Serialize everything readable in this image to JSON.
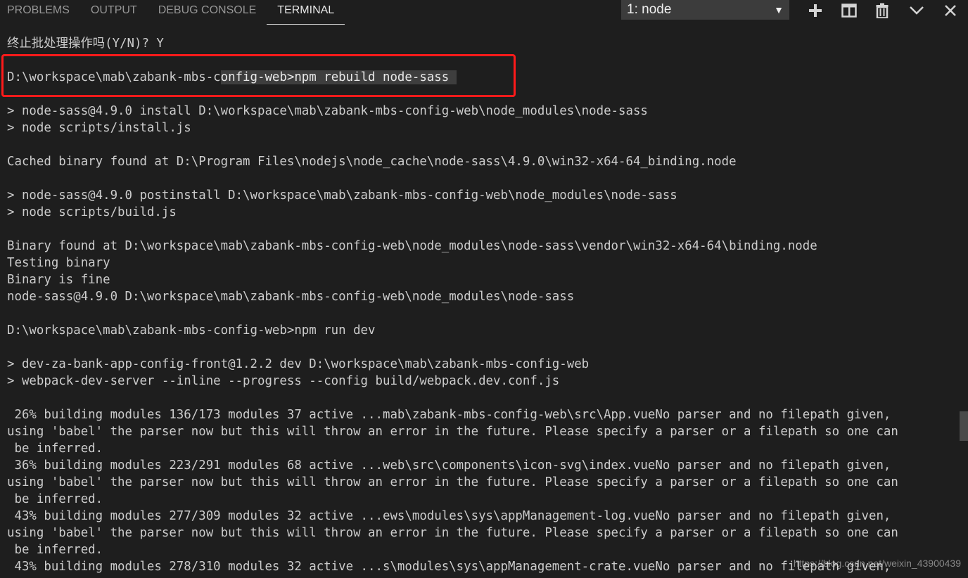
{
  "panel": {
    "tabs": [
      {
        "label": "PROBLEMS"
      },
      {
        "label": "OUTPUT"
      },
      {
        "label": "DEBUG CONSOLE"
      },
      {
        "label": "TERMINAL"
      }
    ],
    "active_tab": "TERMINAL",
    "terminal_select": {
      "value": "1: node"
    },
    "icons": [
      "plus-icon",
      "split-terminal-icon",
      "trash-icon",
      "chevron-down-icon",
      "close-icon"
    ]
  },
  "terminal": {
    "lines": [
      "终止批处理操作吗(Y/N)? Y",
      "",
      "",
      "",
      "> node-sass@4.9.0 install D:\\workspace\\mab\\zabank-mbs-config-web\\node_modules\\node-sass",
      "> node scripts/install.js",
      "",
      "Cached binary found at D:\\Program Files\\nodejs\\node_cache\\node-sass\\4.9.0\\win32-x64-64_binding.node",
      "",
      "> node-sass@4.9.0 postinstall D:\\workspace\\mab\\zabank-mbs-config-web\\node_modules\\node-sass",
      "> node scripts/build.js",
      "",
      "Binary found at D:\\workspace\\mab\\zabank-mbs-config-web\\node_modules\\node-sass\\vendor\\win32-x64-64\\binding.node",
      "Testing binary",
      "Binary is fine",
      "node-sass@4.9.0 D:\\workspace\\mab\\zabank-mbs-config-web\\node_modules\\node-sass",
      "",
      "D:\\workspace\\mab\\zabank-mbs-config-web>npm run dev",
      "",
      "> dev-za-bank-app-config-front@1.2.2 dev D:\\workspace\\mab\\zabank-mbs-config-web",
      "> webpack-dev-server --inline --progress --config build/webpack.dev.conf.js",
      "",
      "",
      " 26% building modules 136/173 modules 37 active ...mab\\zabank-mbs-config-web\\src\\App.vueNo parser and no filepath given,",
      "using 'babel' the parser now but this will throw an error in the future. Please specify a parser or a filepath so one can",
      " be inferred.",
      " 36% building modules 223/291 modules 68 active ...web\\src\\components\\icon-svg\\index.vueNo parser and no filepath given,",
      "using 'babel' the parser now but this will throw an error in the future. Please specify a parser or a filepath so one can",
      " be inferred.",
      " 43% building modules 277/309 modules 32 active ...ews\\modules\\sys\\appManagement-log.vueNo parser and no filepath given,",
      "using 'babel' the parser now but this will throw an error in the future. Please specify a parser or a filepath so one can",
      " be inferred.",
      " 43% building modules 278/310 modules 32 active ...s\\modules\\sys\\appManagement-crate.vueNo parser and no filepath given,"
    ],
    "highlighted_command": {
      "prefix": "D:\\workspace\\mab\\zabank-mbs-c",
      "selected": "onfig-web>npm rebuild node-sass "
    }
  },
  "watermark": "https://blog.csdn.net/weixin_43900439"
}
